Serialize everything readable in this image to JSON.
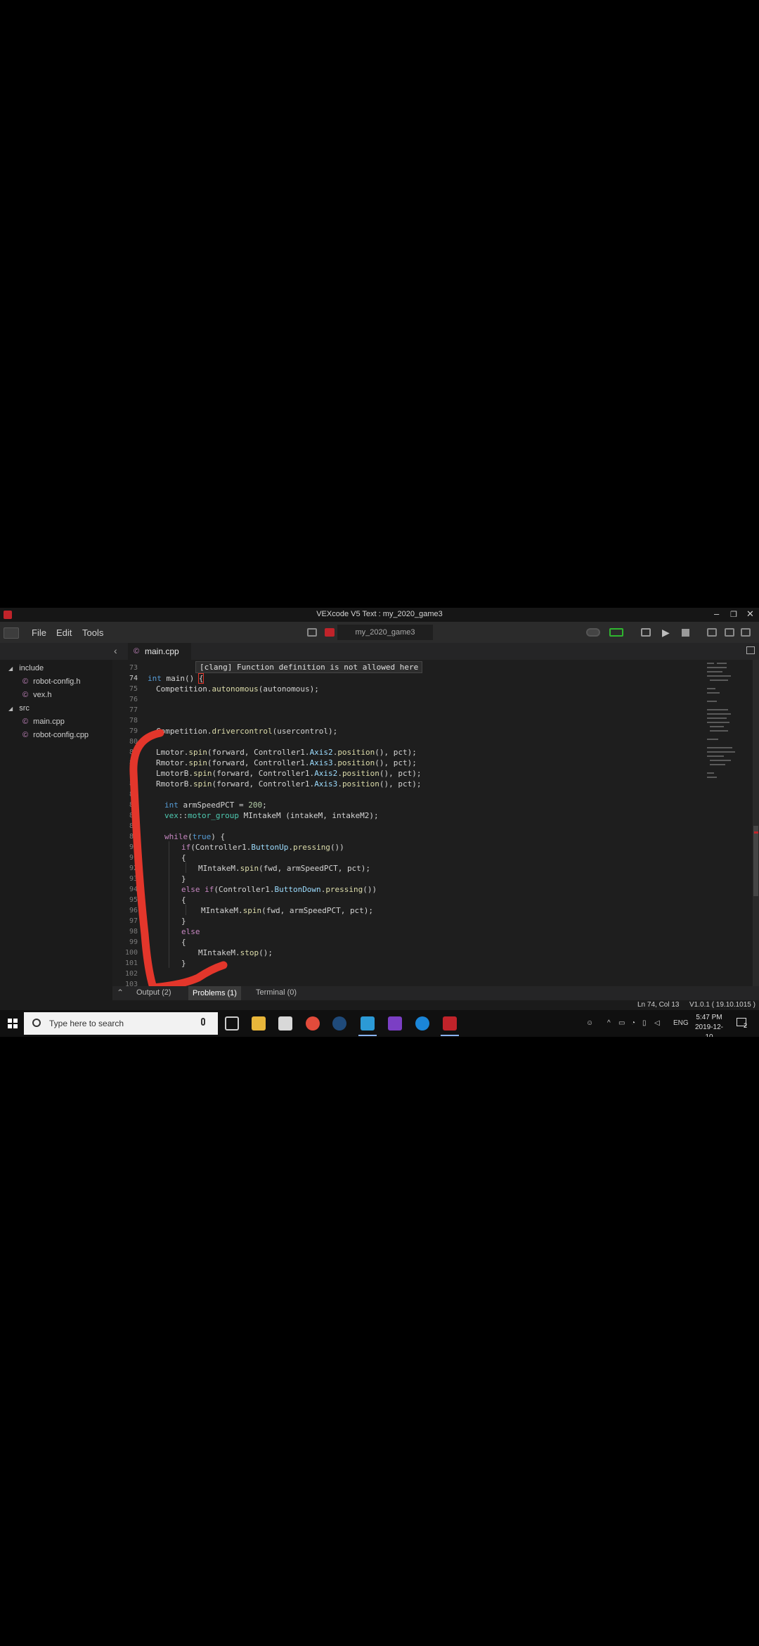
{
  "window": {
    "title": "VEXcode V5 Text : my_2020_game3"
  },
  "menu": {
    "file": "File",
    "edit": "Edit",
    "tools": "Tools"
  },
  "toolbar": {
    "project_name": "my_2020_game3"
  },
  "tabs": [
    {
      "label": "main.cpp"
    }
  ],
  "sidebar": {
    "include_label": "include",
    "include_files": [
      "robot-config.h",
      "vex.h"
    ],
    "src_label": "src",
    "src_files": [
      "main.cpp",
      "robot-config.cpp"
    ]
  },
  "editor": {
    "tooltip": "[clang] Function definition is not allowed here",
    "line_numbers": [
      "73",
      "74",
      "75",
      "76",
      "77",
      "78",
      "79",
      "80",
      "81",
      "82",
      "83",
      "84",
      "85",
      "86",
      "87",
      "88",
      "89",
      "90",
      "91",
      "92",
      "93",
      "94",
      "95",
      "96",
      "97",
      "98",
      "99",
      "100",
      "101",
      "102",
      "103"
    ],
    "code": {
      "l74": [
        "int",
        " main() ",
        "{"
      ],
      "l75": [
        "Competition.",
        "autonomous",
        "(autonomous);"
      ],
      "l79": [
        "Competition.",
        "drivercontrol",
        "(usercontrol);"
      ],
      "l81": [
        "Lmotor.",
        "spin",
        "(forward, Controller1.",
        "Axis2",
        ".",
        "position",
        "(), pct);"
      ],
      "l82": [
        "Rmotor.",
        "spin",
        "(forward, Controller1.",
        "Axis3",
        ".",
        "position",
        "(), pct);"
      ],
      "l83": [
        "LmotorB.",
        "spin",
        "(forward, Controller1.",
        "Axis2",
        ".",
        "position",
        "(), pct);"
      ],
      "l84": [
        "RmotorB.",
        "spin",
        "(forward, Controller1.",
        "Axis3",
        ".",
        "position",
        "(), pct);"
      ],
      "l86": [
        "int",
        " armSpeedPCT = ",
        "200",
        ";"
      ],
      "l87": [
        "vex",
        "::",
        "motor_group",
        " MIntakeM (intakeM, intakeM2);"
      ],
      "l89": [
        "while",
        "(",
        "true",
        ") {"
      ],
      "l90": [
        "if",
        "(Controller1.",
        "ButtonUp",
        ".",
        "pressing",
        "())"
      ],
      "l91": "{",
      "l92": [
        "MIntakeM.",
        "spin",
        "(fwd, armSpeedPCT, pct);"
      ],
      "l93": "}",
      "l94": [
        "else if",
        "(Controller1.",
        "ButtonDown",
        ".",
        "pressing",
        "())"
      ],
      "l95": "{",
      "l96": [
        "MIntakeM.",
        "spin",
        "(fwd, armSpeedPCT, pct);"
      ],
      "l97": "}",
      "l98": "else",
      "l99": "{",
      "l100": [
        "MIntakeM.",
        "stop",
        "();"
      ],
      "l101": "}"
    }
  },
  "panel": {
    "output": "Output (2)",
    "problems": "Problems (1)",
    "terminal": "Terminal (0)"
  },
  "status": {
    "position": "Ln 74, Col 13",
    "version": "V1.0.1 ( 19.10.1015 )"
  },
  "taskbar": {
    "search_placeholder": "Type here to search",
    "lang": "ENG",
    "time": "5:47 PM",
    "date": "2019-12-10",
    "notification_count": "2"
  },
  "colors": {
    "accent_red": "#c0232a",
    "annotation_red": "#e3362b",
    "background": "#1e1e1e"
  }
}
